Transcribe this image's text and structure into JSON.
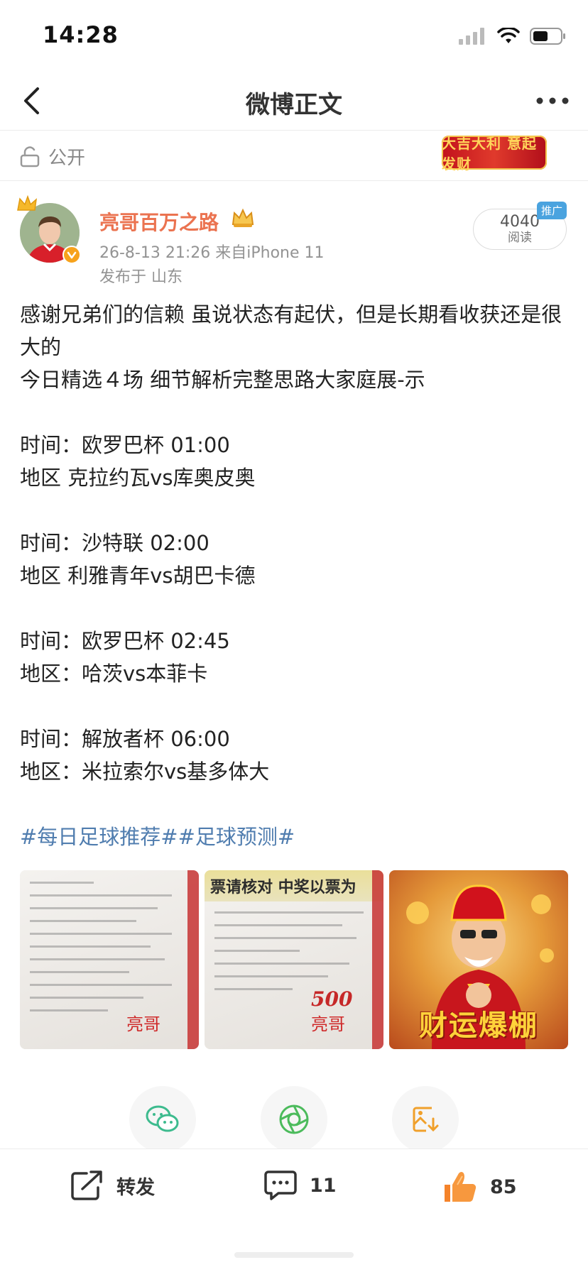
{
  "status_bar": {
    "time": "14:28"
  },
  "nav": {
    "title": "微博正文"
  },
  "visibility": {
    "label": "公开",
    "banner_text": "大吉大利 意起发财"
  },
  "author": {
    "name": "亮哥百万之路",
    "meta": "26-8-13 21:26  来自iPhone 11",
    "location": "发布于 山东"
  },
  "reads": {
    "count": "4040",
    "label": "阅读",
    "promo_tag": "推广"
  },
  "post": {
    "lines": [
      "感谢兄弟们的信赖 虽说状态有起伏，但是长期看收获还是很大的",
      "今日精选４场 细节解析完整思路大家庭展-示",
      "",
      "时间：欧罗巴杯 01:00",
      "地区 克拉约瓦vs库奥皮奥",
      "",
      "时间：沙特联 02:00",
      "地区 利雅青年vs胡巴卡德",
      "",
      "时间：欧罗巴杯 02:45",
      "地区：哈茨vs本菲卡",
      "",
      "时间：解放者杯 06:00",
      "地区：米拉索尔vs基多体大"
    ],
    "hashtags": "#每日足球推荐##足球预测#"
  },
  "images": {
    "ticket2_header": "票请核对 中奖以票为",
    "ticket_sign": "亮哥",
    "ticket2_amount": "500",
    "god_caption": "财运爆棚"
  },
  "actions": {
    "repost_label": "转发",
    "comment_count": "11",
    "like_count": "85"
  },
  "colors": {
    "username": "#eb7350",
    "hashtag": "#507daf",
    "like": "#f5832a"
  }
}
